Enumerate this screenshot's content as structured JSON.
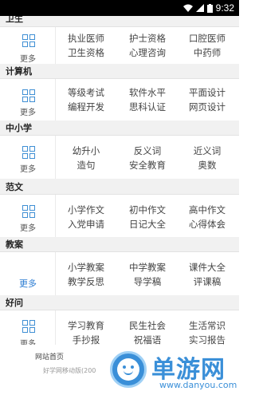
{
  "status_bar": {
    "time": "9:32",
    "icons": [
      "wifi-icon",
      "signal-icon",
      "battery-icon"
    ]
  },
  "sections": [
    {
      "title": "卫生",
      "more_label": "更多",
      "links": [
        "执业医师",
        "护士资格",
        "口腔医师",
        "卫生资格",
        "心理咨询",
        "中药师"
      ]
    },
    {
      "title": "计算机",
      "more_label": "更多",
      "links": [
        "等级考试",
        "软件水平",
        "平面设计",
        "编程开发",
        "思科认证",
        "网页设计"
      ]
    },
    {
      "title": "中小学",
      "more_label": "更多",
      "links": [
        "幼升小",
        "反义词",
        "近义词",
        "造句",
        "安全教育",
        "奥数"
      ]
    },
    {
      "title": "范文",
      "more_label": "更多",
      "links": [
        "小学作文",
        "初中作文",
        "高中作文",
        "入党申请",
        "日记大全",
        "心得体会"
      ]
    },
    {
      "title": "教案",
      "more_label": "更多",
      "links": [
        "小学教案",
        "中学教案",
        "课件大全",
        "教学反思",
        "导学稿",
        "评课稿"
      ]
    },
    {
      "title": "好问",
      "more_label": "更多",
      "links": [
        "学习教育",
        "民生社会",
        "生活常识",
        "手抄报",
        "祝福语",
        "实习报告"
      ]
    }
  ],
  "footer": {
    "home_link": "网站首页",
    "version_text": "好学网移动版(200"
  },
  "watermark": {
    "brand": "单游网",
    "domain": "www.danyou.com",
    "color": "#3a8fd8"
  }
}
